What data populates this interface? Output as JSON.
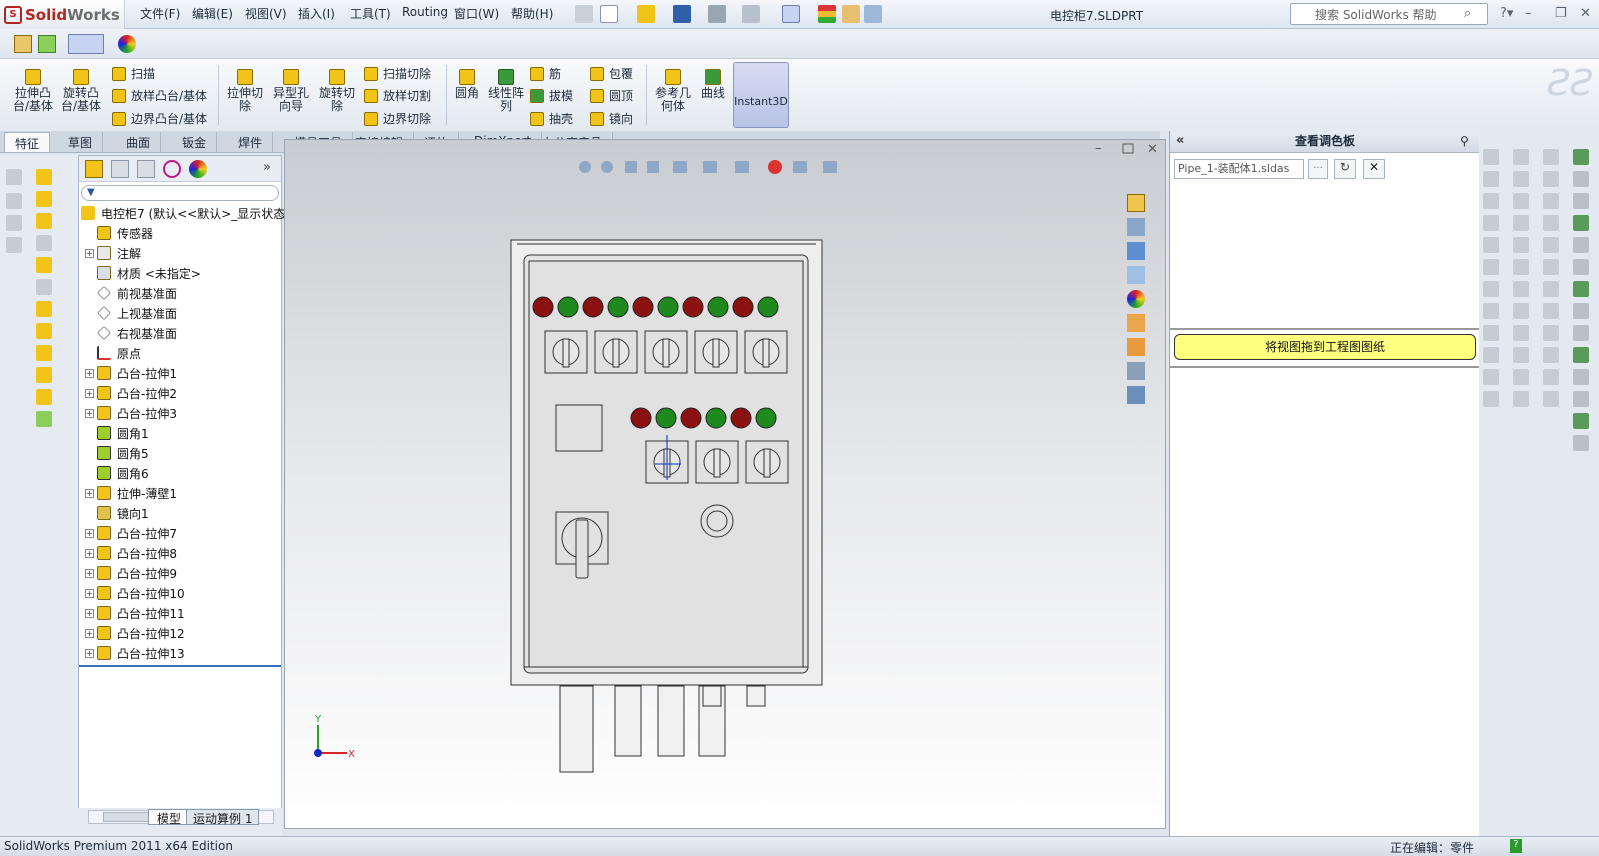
{
  "app": {
    "name_red": "Solid",
    "name_gray": "Works"
  },
  "menu": [
    "文件(F)",
    "编辑(E)",
    "视图(V)",
    "插入(I)",
    "工具(T)",
    "Routing",
    "窗口(W)",
    "帮助(H)"
  ],
  "doc_title": "电控柜7.SLDPRT",
  "search": {
    "placeholder": "搜索 SolidWorks 帮助"
  },
  "command_manager": {
    "big": [
      "拉伸凸\n台/基体",
      "旋转凸\n台/基体",
      "拉伸切\n除",
      "异型孔\n向导",
      "旋转切\n除",
      "圆角",
      "线性阵\n列",
      "参考几\n何体",
      "曲线"
    ],
    "small_col1": [
      "扫描",
      "放样凸台/基体",
      "边界凸台/基体"
    ],
    "small_col2": [
      "扫描切除",
      "放样切割",
      "边界切除"
    ],
    "small_col3": [
      "筋",
      "拔模",
      "抽壳"
    ],
    "small_col4": [
      "包覆",
      "圆顶",
      "镜向"
    ],
    "instant3d": "Instant3D"
  },
  "tabs": [
    "特征",
    "草图",
    "曲面",
    "钣金",
    "焊件",
    "模具工具",
    "直接编辑",
    "评估",
    "DimXpert",
    "办公室产品"
  ],
  "feature_tree": {
    "root": "电控柜7  (默认<<默认>_显示状态",
    "nodes": [
      {
        "label": "传感器",
        "exp": false
      },
      {
        "label": "注解",
        "exp": true
      },
      {
        "label": "材质 <未指定>",
        "exp": false
      },
      {
        "label": "前视基准面",
        "exp": false
      },
      {
        "label": "上视基准面",
        "exp": false
      },
      {
        "label": "右视基准面",
        "exp": false
      },
      {
        "label": "原点",
        "exp": false
      },
      {
        "label": "凸台-拉伸1",
        "exp": true
      },
      {
        "label": "凸台-拉伸2",
        "exp": true
      },
      {
        "label": "凸台-拉伸3",
        "exp": true
      },
      {
        "label": "圆角1",
        "exp": false
      },
      {
        "label": "圆角5",
        "exp": false
      },
      {
        "label": "圆角6",
        "exp": false
      },
      {
        "label": "拉伸-薄壁1",
        "exp": true
      },
      {
        "label": "镜向1",
        "exp": false
      },
      {
        "label": "凸台-拉伸7",
        "exp": true
      },
      {
        "label": "凸台-拉伸8",
        "exp": true
      },
      {
        "label": "凸台-拉伸9",
        "exp": true
      },
      {
        "label": "凸台-拉伸10",
        "exp": true
      },
      {
        "label": "凸台-拉伸11",
        "exp": true
      },
      {
        "label": "凸台-拉伸12",
        "exp": true
      },
      {
        "label": "凸台-拉伸13",
        "exp": true
      }
    ]
  },
  "bottom_tabs": [
    "模型",
    "运动算例 1"
  ],
  "palette": {
    "title": "查看调色板",
    "select_value": "Pipe_1-装配体1.sldas",
    "drag_button": "将视图拖到工程图图纸"
  },
  "status": {
    "left": "SolidWorks Premium 2011 x64 Edition",
    "right": "正在编辑：零件"
  },
  "axis": {
    "y": "Y",
    "x": "X"
  },
  "colors": {
    "red_light": "#8c1212",
    "green_light": "#1e8a1e",
    "accent": "#f2c418",
    "palette_button": "#ffff80"
  }
}
